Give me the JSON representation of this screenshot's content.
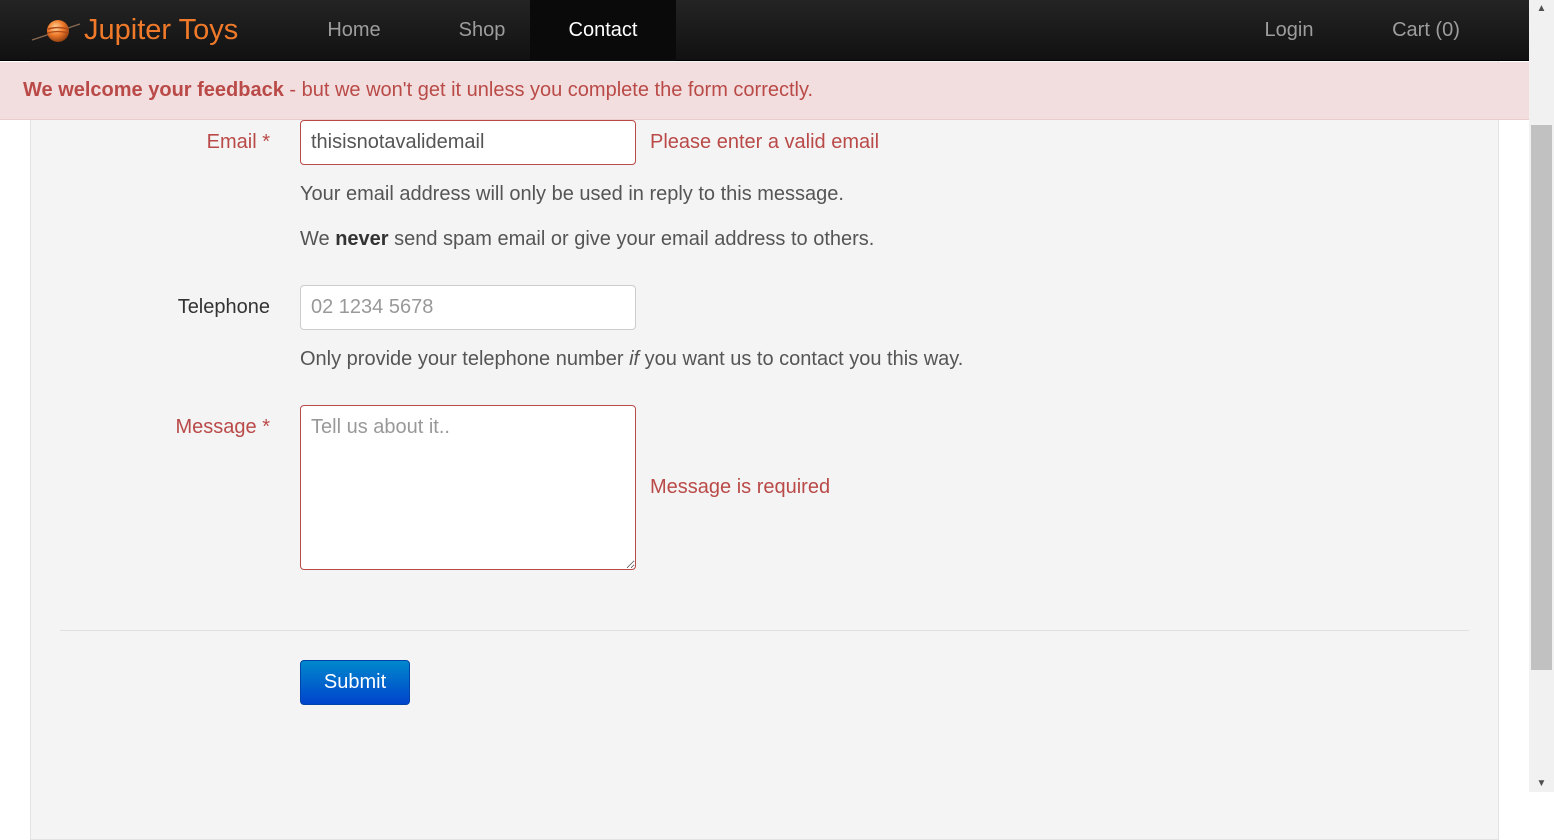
{
  "nav": {
    "brand": "Jupiter Toys",
    "items": [
      {
        "label": "Home"
      },
      {
        "label": "Shop"
      },
      {
        "label": "Contact"
      }
    ],
    "login": "Login",
    "cart": "Cart (0)"
  },
  "alert": {
    "strong": "We welcome your feedback",
    "rest": " - but we won't get it unless you complete the form correctly."
  },
  "form": {
    "email": {
      "label": "Email",
      "required": "*",
      "value": "thisisnotavalidemail",
      "error": "Please enter a valid email",
      "help1": "Your email address will only be used in reply to this message.",
      "help2_pre": "We ",
      "help2_strong": "never",
      "help2_post": " send spam email or give your email address to others."
    },
    "telephone": {
      "label": "Telephone",
      "placeholder": "02 1234 5678",
      "help_pre": "Only provide your telephone number ",
      "help_em": "if",
      "help_post": " you want us to contact you this way."
    },
    "message": {
      "label": "Message",
      "required": "*",
      "placeholder": "Tell us about it..",
      "error": "Message is required"
    },
    "submit": "Submit"
  },
  "colors": {
    "brand": "#f07a2a",
    "error": "#b94a48",
    "alert_bg": "#f2dede",
    "primary": "#0055cc"
  }
}
